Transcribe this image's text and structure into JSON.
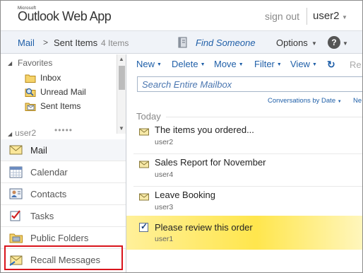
{
  "header": {
    "logo_small": "Microsoft",
    "app_title": "Outlook Web App",
    "sign_out": "sign out",
    "user_name": "user2"
  },
  "navbar": {
    "crumb_root": "Mail",
    "crumb_arrow": ">",
    "crumb_folder": "Sent Items",
    "item_count": "4 Items",
    "find_someone": "Find Someone",
    "options": "Options",
    "help": "?"
  },
  "left": {
    "favorites_label": "Favorites",
    "folders": [
      {
        "label": "Inbox",
        "icon": "inbox-folder-icon"
      },
      {
        "label": "Unread Mail",
        "icon": "search-folder-icon"
      },
      {
        "label": "Sent Items",
        "icon": "sent-items-icon"
      }
    ],
    "user_section": "user2",
    "user_dots": "•••••",
    "nav": [
      {
        "label": "Mail",
        "icon": "mail-icon",
        "active": true
      },
      {
        "label": "Calendar",
        "icon": "calendar-icon"
      },
      {
        "label": "Contacts",
        "icon": "contacts-icon"
      },
      {
        "label": "Tasks",
        "icon": "tasks-icon"
      },
      {
        "label": "Public Folders",
        "icon": "public-folders-icon"
      },
      {
        "label": "Recall Messages",
        "icon": "recall-messages-icon",
        "highlight_color": "#d9141c"
      }
    ]
  },
  "toolbar": {
    "new": "New",
    "delete": "Delete",
    "move": "Move",
    "filter": "Filter",
    "view": "View",
    "truncated": "Re"
  },
  "search": {
    "placeholder": "Search Entire Mailbox"
  },
  "sort": {
    "conversations_by": "Conversations by Date",
    "truncated": "Ne"
  },
  "messages": {
    "group": "Today",
    "items": [
      {
        "subject": "The items you ordered...",
        "from": "user2"
      },
      {
        "subject": "Sales Report for November",
        "from": "user4"
      },
      {
        "subject": "Leave Booking",
        "from": "user3"
      },
      {
        "subject": "Please review this order",
        "from": "user1",
        "selected": true
      }
    ]
  },
  "colors": {
    "accent": "#1f5fa8",
    "selection": "#ffe64d",
    "highlight_border": "#d9141c"
  }
}
